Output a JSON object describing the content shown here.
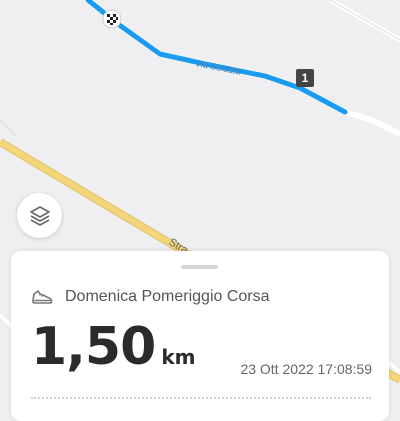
{
  "map": {
    "street_label": "Via Soldata",
    "road_label": "Stra",
    "lap_marker": "1",
    "route_color": "#1a9bf0",
    "road_color": "#f3d57a",
    "background_color": "#efeff1"
  },
  "controls": {
    "layers_icon": "layers-icon"
  },
  "activity": {
    "icon": "running-shoe-icon",
    "title": "Domenica Pomeriggio Corsa",
    "distance_value": "1,50",
    "distance_unit": "km",
    "timestamp": "23 Ott 2022 17:08:59"
  }
}
